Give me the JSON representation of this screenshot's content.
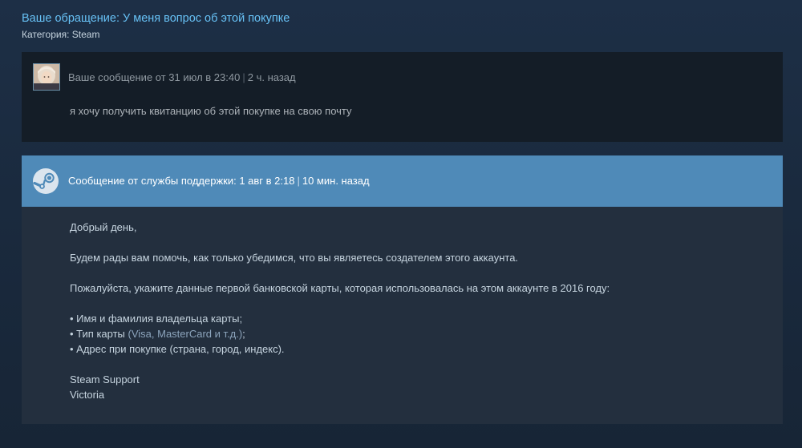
{
  "ticket": {
    "title": "Ваше обращение: У меня вопрос об этой покупке",
    "category_label": "Категория: ",
    "category_value": "Steam"
  },
  "user_message": {
    "meta_prefix": "Ваше сообщение от 31 июл в 23:40",
    "meta_separator": "|",
    "meta_ago": "2 ч. назад",
    "body": "я хочу получить квитанцию об этой покупке на свою почту"
  },
  "support_message": {
    "meta_prefix": "Сообщение от службы поддержки: 1 авг в 2:18",
    "meta_separator": "|",
    "meta_ago": "10 мин. назад",
    "greeting": "Добрый день,",
    "para1": "Будем рады вам помочь, как только убедимся, что вы являетесь создателем этого аккаунта.",
    "para2": "Пожалуйста, укажите данные первой банковской карты, которая использовалась на этом аккаунте в 2016 году:",
    "bullet1": "• Имя и фамилия владельца карты;",
    "bullet2_prefix": "• Тип карты ",
    "bullet2_highlight": "(Visa, MasterCard и т.д.)",
    "bullet2_suffix": ";",
    "bullet3": "• Адрес при покупке (страна, город, индекс).",
    "signature_team": "Steam Support",
    "signature_name": "Victoria"
  },
  "colors": {
    "link": "#67c1f5",
    "support_header": "#4f8ab8",
    "user_panel": "#141d27",
    "support_panel": "#232f3e"
  },
  "icons": {
    "avatar": "user-avatar",
    "support": "steam-logo-icon"
  }
}
